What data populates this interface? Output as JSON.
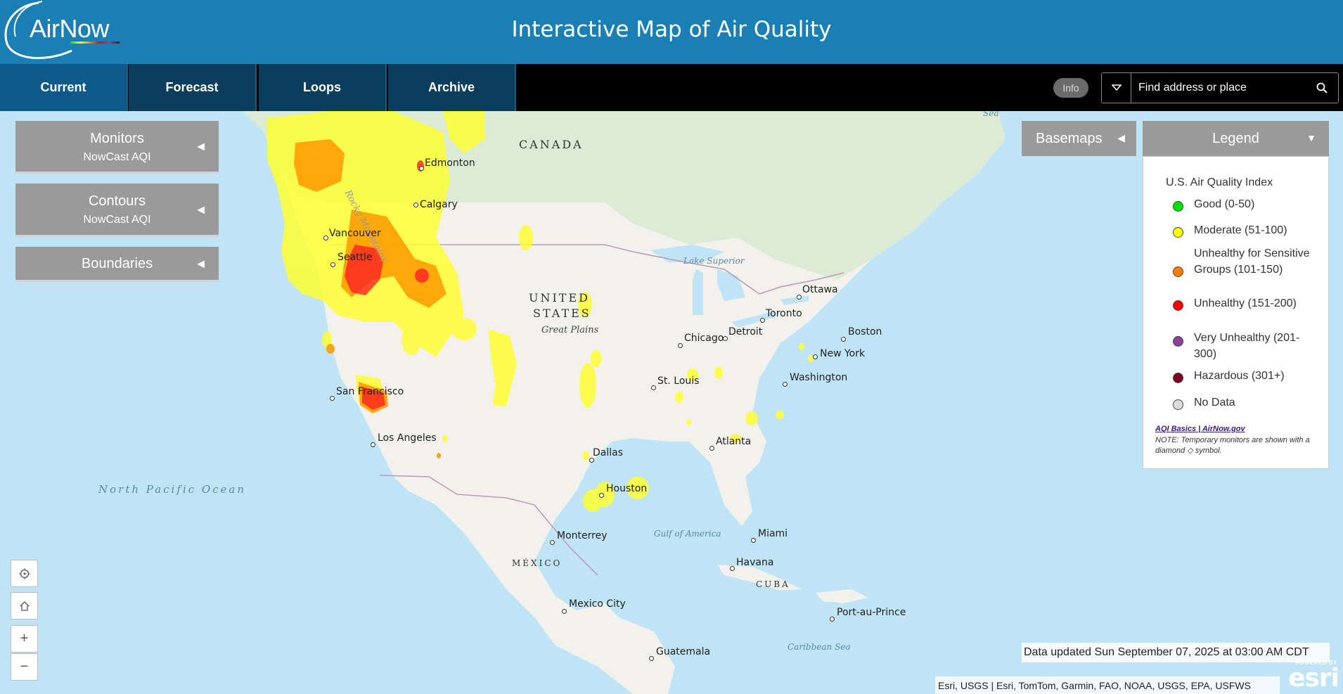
{
  "header": {
    "logo_text": "AirNow",
    "title": "Interactive Map of Air Quality"
  },
  "nav": {
    "tabs": [
      {
        "label": "Current",
        "active": true
      },
      {
        "label": "Forecast",
        "active": false
      },
      {
        "label": "Loops",
        "active": false
      },
      {
        "label": "Archive",
        "active": false
      }
    ],
    "info_label": "Info",
    "search_placeholder": "Find address or place",
    "search_icon": "search-icon",
    "dropdown_icon": "caret-down-icon"
  },
  "left_panels": [
    {
      "title": "Monitors",
      "subtitle": "NowCast AQI"
    },
    {
      "title": "Contours",
      "subtitle": "NowCast AQI"
    },
    {
      "title": "Boundaries",
      "subtitle": ""
    }
  ],
  "basemaps": {
    "label": "Basemaps"
  },
  "legend": {
    "header": "Legend",
    "title": "U.S. Air Quality Index",
    "items": [
      {
        "label": "Good (0-50)",
        "color": "#00e400"
      },
      {
        "label": "Moderate (51-100)",
        "color": "#ffff00"
      },
      {
        "label": "Unhealthy for Sensitive Groups (101-150)",
        "color": "#ff7e00"
      },
      {
        "label": "Unhealthy (151-200)",
        "color": "#ff0000"
      },
      {
        "label": "Very Unhealthy (201-300)",
        "color": "#8f3f97"
      },
      {
        "label": "Hazardous (301+)",
        "color": "#7e0023"
      },
      {
        "label": "No Data",
        "color": "#dddddd"
      }
    ],
    "link": "AQI Basics | AirNow.gov",
    "note": "NOTE: Temporary monitors are shown with a diamond ◇ symbol."
  },
  "map": {
    "countries": [
      "CANADA",
      "UNITED",
      "STATES",
      "MÉXICO",
      "CUBA"
    ],
    "cities": [
      "Edmonton",
      "Calgary",
      "Vancouver",
      "Seattle",
      "San Francisco",
      "Los Angeles",
      "Dallas",
      "Houston",
      "Chicago",
      "Detroit",
      "Toronto",
      "Ottawa",
      "Boston",
      "New York",
      "Washington",
      "St. Louis",
      "Atlanta",
      "Miami",
      "Havana",
      "Monterrey",
      "Mexico City",
      "Guatemala",
      "Port-au-Prince"
    ],
    "waters": [
      "Lake Superior",
      "Gulf of America",
      "Caribbean Sea",
      "North Pacific Ocean",
      "Sea"
    ],
    "regions": [
      "Great Plains",
      "Rocky Mountains"
    ]
  },
  "controls": {
    "locate_icon": "locate-icon",
    "home_icon": "home-icon",
    "zoom_in": "+",
    "zoom_out": "−"
  },
  "status": {
    "updated": "Data updated Sun September 07, 2025 at 03:00 AM CDT",
    "attribution": "Esri, USGS | Esri, TomTom, Garmin, FAO, NOAA, USGS, EPA, USFWS",
    "powered_by": "POWERED BY",
    "esri": "esri"
  }
}
